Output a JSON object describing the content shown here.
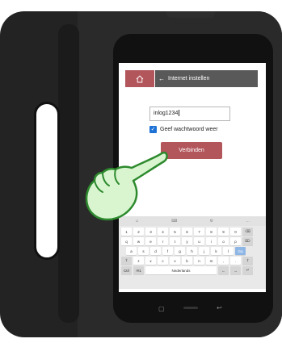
{
  "header": {
    "back_glyph": "←",
    "title": "Internet instellen"
  },
  "form": {
    "password_value": "inlog1234",
    "show_password_label": "Geef wachtwoord weer",
    "show_password_checked": true,
    "connect_label": "Verbinden"
  },
  "keyboard": {
    "toolbar": [
      "☺",
      "⌨",
      "⚙",
      "…"
    ],
    "rows": [
      [
        "1",
        "2",
        "3",
        "4",
        "5",
        "6",
        "7",
        "8",
        "9",
        "0"
      ],
      [
        "q",
        "w",
        "e",
        "r",
        "t",
        "y",
        "u",
        "i",
        "o",
        "p"
      ],
      [
        "a",
        "s",
        "d",
        "f",
        "g",
        "h",
        "j",
        "k",
        "l"
      ],
      [
        "⇧",
        "z",
        "x",
        "c",
        "v",
        "b",
        "n",
        "m",
        ",",
        "."
      ],
      [
        "Ctrl",
        "!#1",
        "Nederlands",
        "←",
        "→",
        "↵"
      ]
    ]
  },
  "colors": {
    "accent": "#b3565c",
    "title_bar": "#595959",
    "checkbox": "#1e72d6",
    "case": "#232323"
  },
  "icons": {
    "home": "home-icon",
    "pointer": "pointing-hand-icon"
  }
}
